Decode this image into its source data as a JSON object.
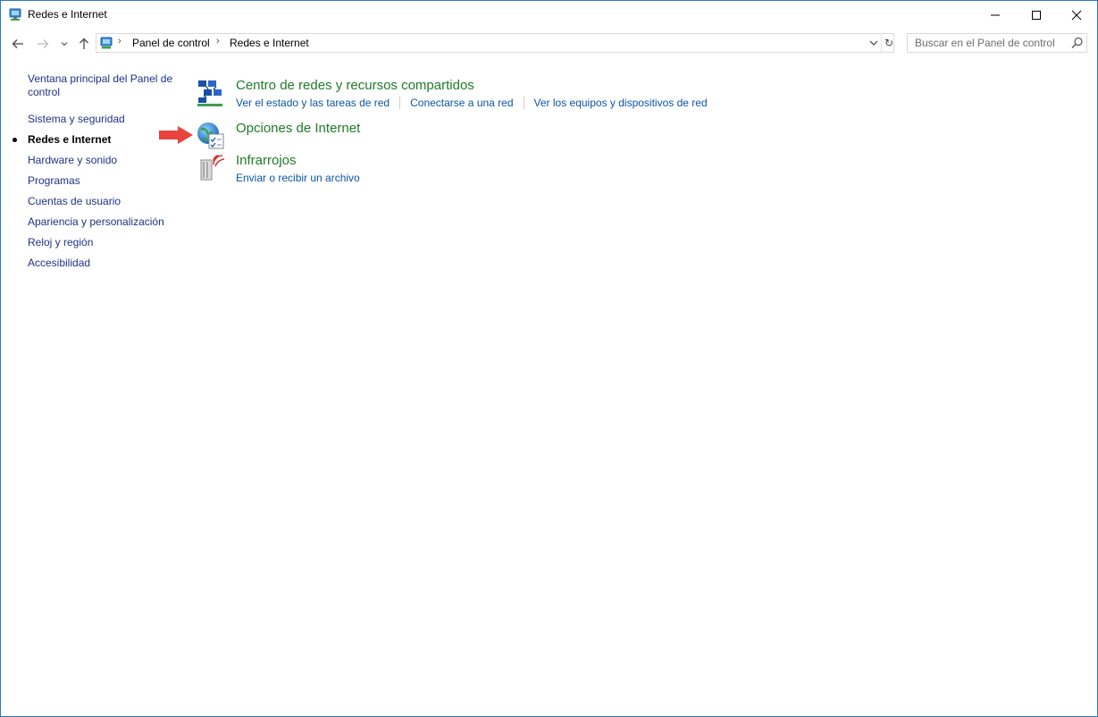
{
  "window": {
    "title": "Redes e Internet"
  },
  "navigation": {
    "breadcrumbs": [
      "Panel de control",
      "Redes e Internet"
    ],
    "search_placeholder": "Buscar en el Panel de control"
  },
  "sidebar": {
    "items": [
      {
        "label": "Ventana principal del Panel de control",
        "current": false
      },
      {
        "label": "Sistema y seguridad",
        "current": false
      },
      {
        "label": "Redes e Internet",
        "current": true
      },
      {
        "label": "Hardware y sonido",
        "current": false
      },
      {
        "label": "Programas",
        "current": false
      },
      {
        "label": "Cuentas de usuario",
        "current": false
      },
      {
        "label": "Apariencia y personalización",
        "current": false
      },
      {
        "label": "Reloj y región",
        "current": false
      },
      {
        "label": "Accesibilidad",
        "current": false
      }
    ]
  },
  "main": {
    "categories": [
      {
        "title": "Centro de redes y recursos compartidos",
        "icon": "network-center-icon",
        "links": [
          "Ver el estado y las tareas de red",
          "Conectarse a una red",
          "Ver los equipos y dispositivos de red"
        ]
      },
      {
        "title": "Opciones de Internet",
        "icon": "internet-options-icon",
        "links": []
      },
      {
        "title": "Infrarrojos",
        "icon": "infrared-icon",
        "links": [
          "Enviar o recibir un archivo"
        ]
      }
    ]
  },
  "colors": {
    "category_title": "#1d7c29",
    "link": "#0a56a5",
    "sidebar_link": "#1e3287",
    "window_border": "#2b79c2",
    "annotation_arrow": "#e8433d"
  }
}
